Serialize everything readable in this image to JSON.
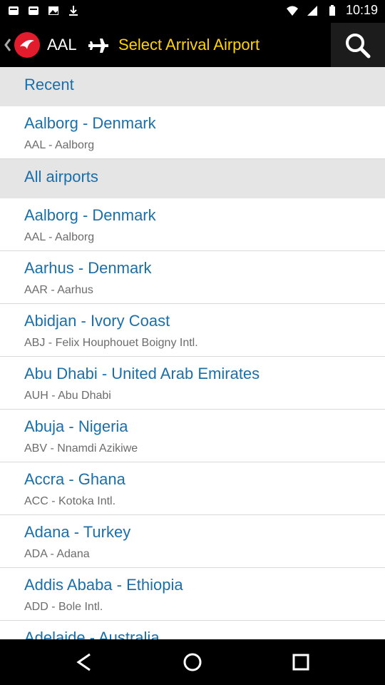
{
  "status_bar": {
    "time": "10:19",
    "icons": [
      "notification-icon",
      "notification-icon",
      "photo-icon",
      "download-icon",
      "wifi-icon",
      "signal-icon",
      "battery-icon"
    ]
  },
  "app_bar": {
    "origin_code": "AAL",
    "title": "Select Arrival Airport",
    "brand_color": "#e21b2d",
    "title_color": "#ffd400"
  },
  "sections": [
    {
      "header": "Recent",
      "items": [
        {
          "city": "Aalborg - Denmark",
          "code": "AAL - Aalborg"
        }
      ]
    },
    {
      "header": "All airports",
      "items": [
        {
          "city": "Aalborg - Denmark",
          "code": "AAL - Aalborg"
        },
        {
          "city": "Aarhus - Denmark",
          "code": "AAR - Aarhus"
        },
        {
          "city": "Abidjan - Ivory Coast",
          "code": "ABJ - Felix Houphouet Boigny Intl."
        },
        {
          "city": "Abu Dhabi - United Arab Emirates",
          "code": "AUH - Abu Dhabi"
        },
        {
          "city": "Abuja - Nigeria",
          "code": "ABV - Nnamdi Azikiwe"
        },
        {
          "city": "Accra - Ghana",
          "code": "ACC - Kotoka Intl."
        },
        {
          "city": "Adana - Turkey",
          "code": "ADA - Adana"
        },
        {
          "city": "Addis Ababa - Ethiopia",
          "code": "ADD - Bole Intl."
        },
        {
          "city": "Adelaide - Australia",
          "code": ""
        }
      ]
    }
  ],
  "colors": {
    "list_link": "#1b6fa8",
    "header_bg": "#e5e5e5",
    "subtitle": "#6c6c6c"
  }
}
